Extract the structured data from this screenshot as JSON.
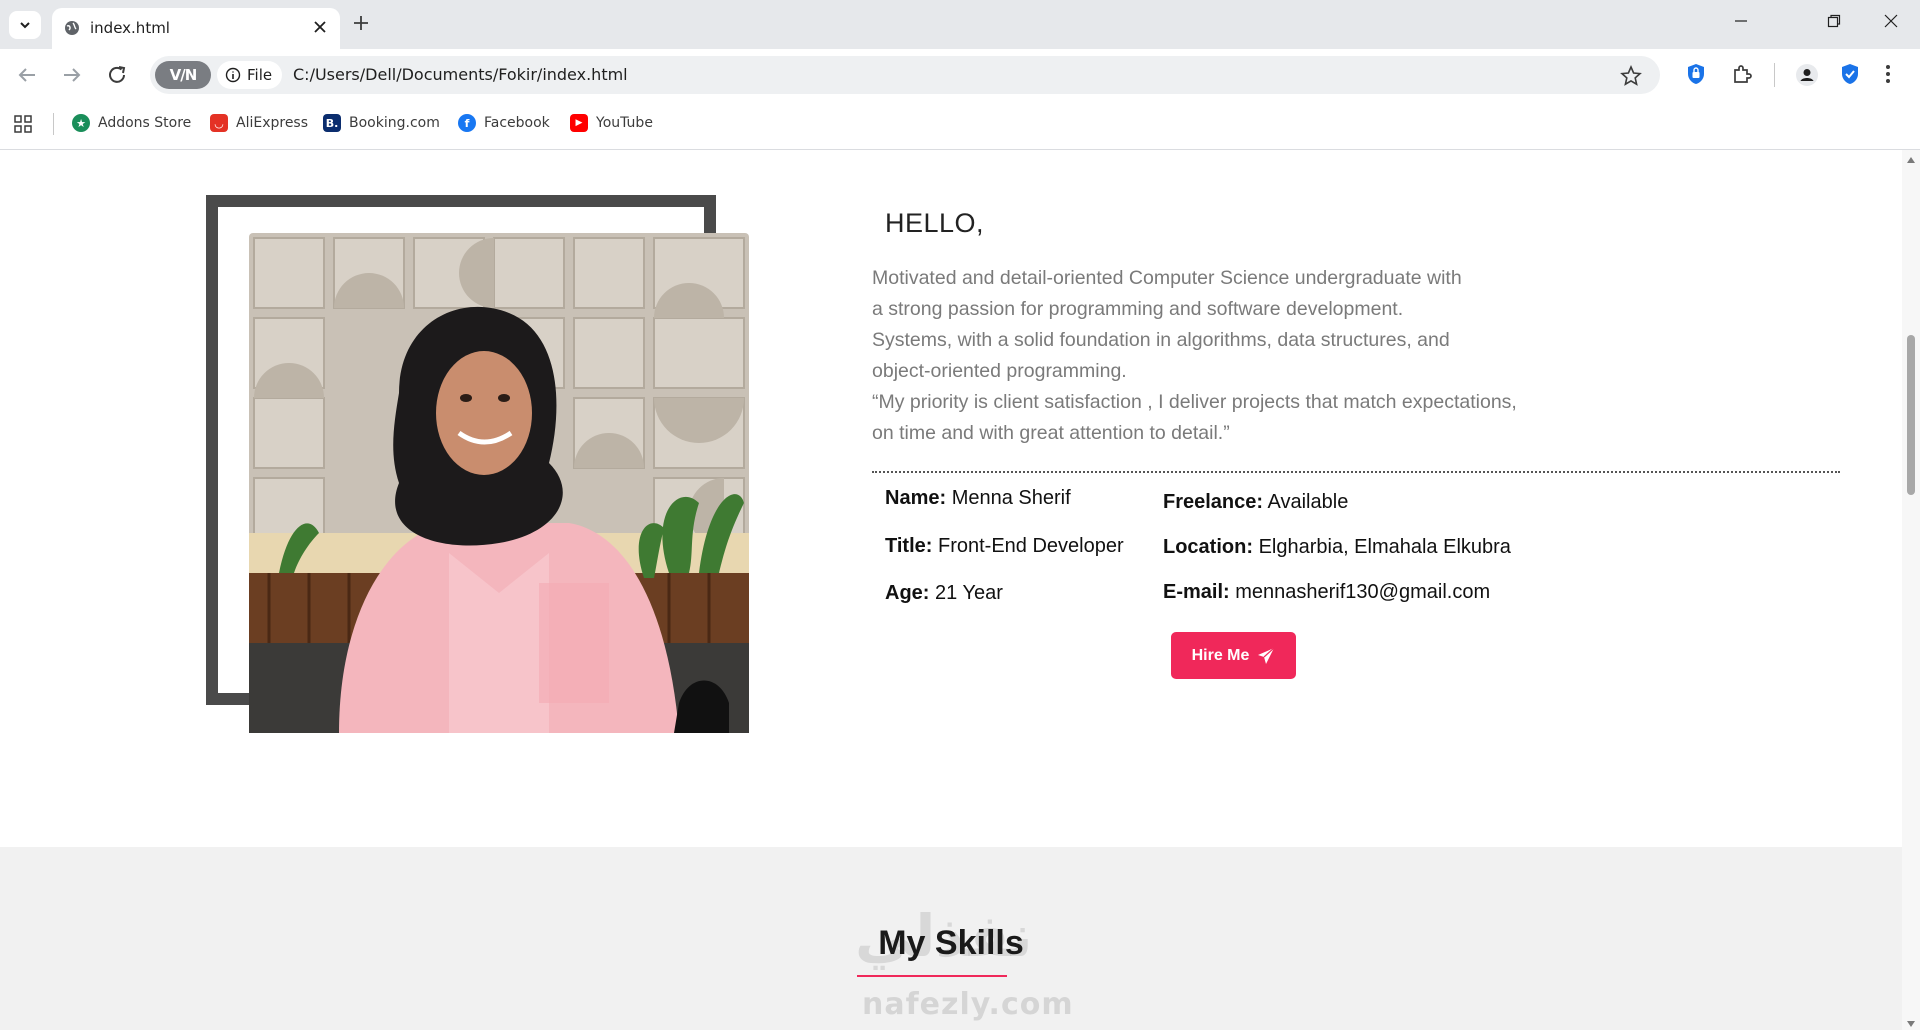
{
  "browser": {
    "tab_title": "index.html",
    "vpn_label": "V/N",
    "file_chip": "File",
    "url": "C:/Users/Dell/Documents/Fokir/index.html",
    "bookmarks": [
      {
        "label": "Addons Store",
        "icon": "addons-store-icon",
        "color": "#1a8e5a"
      },
      {
        "label": "AliExpress",
        "icon": "aliexpress-icon",
        "color": "#e43225"
      },
      {
        "label": "Booking.com",
        "icon": "booking-icon",
        "color": "#0b2d6e"
      },
      {
        "label": "Facebook",
        "icon": "facebook-icon",
        "color": "#1877f2"
      },
      {
        "label": "YouTube",
        "icon": "youtube-icon",
        "color": "#ff0000"
      }
    ]
  },
  "about": {
    "greeting": "HELLO,",
    "bio_lines": [
      "Motivated and detail-oriented Computer Science undergraduate with",
      "a strong passion for programming and software development.",
      "Systems, with a solid foundation in algorithms, data structures, and",
      "object-oriented programming.",
      "“My priority is client satisfaction , I deliver projects that match expectations,",
      "on time and with great attention to detail.”"
    ],
    "info": {
      "name_label": "Name:",
      "name_value": "Menna Sherif",
      "title_label": "Title:",
      "title_value": "Front-End Developer",
      "age_label": "Age:",
      "age_value": "21 Year",
      "freelance_label": "Freelance:",
      "freelance_value": "Available",
      "location_label": "Location:",
      "location_value": "Elgharbia, Elmahala Elkubra",
      "email_label": "E-mail:",
      "email_value": "mennasherif130@gmail.com"
    },
    "hire_button": "Hire Me"
  },
  "skills": {
    "title": "My Skills"
  },
  "watermark": {
    "arabic": "نفذلي",
    "latin": "nafezly.com"
  },
  "colors": {
    "accent": "#f0285a",
    "frame": "#4a4a4a",
    "bio_text": "#7a7a7a"
  }
}
